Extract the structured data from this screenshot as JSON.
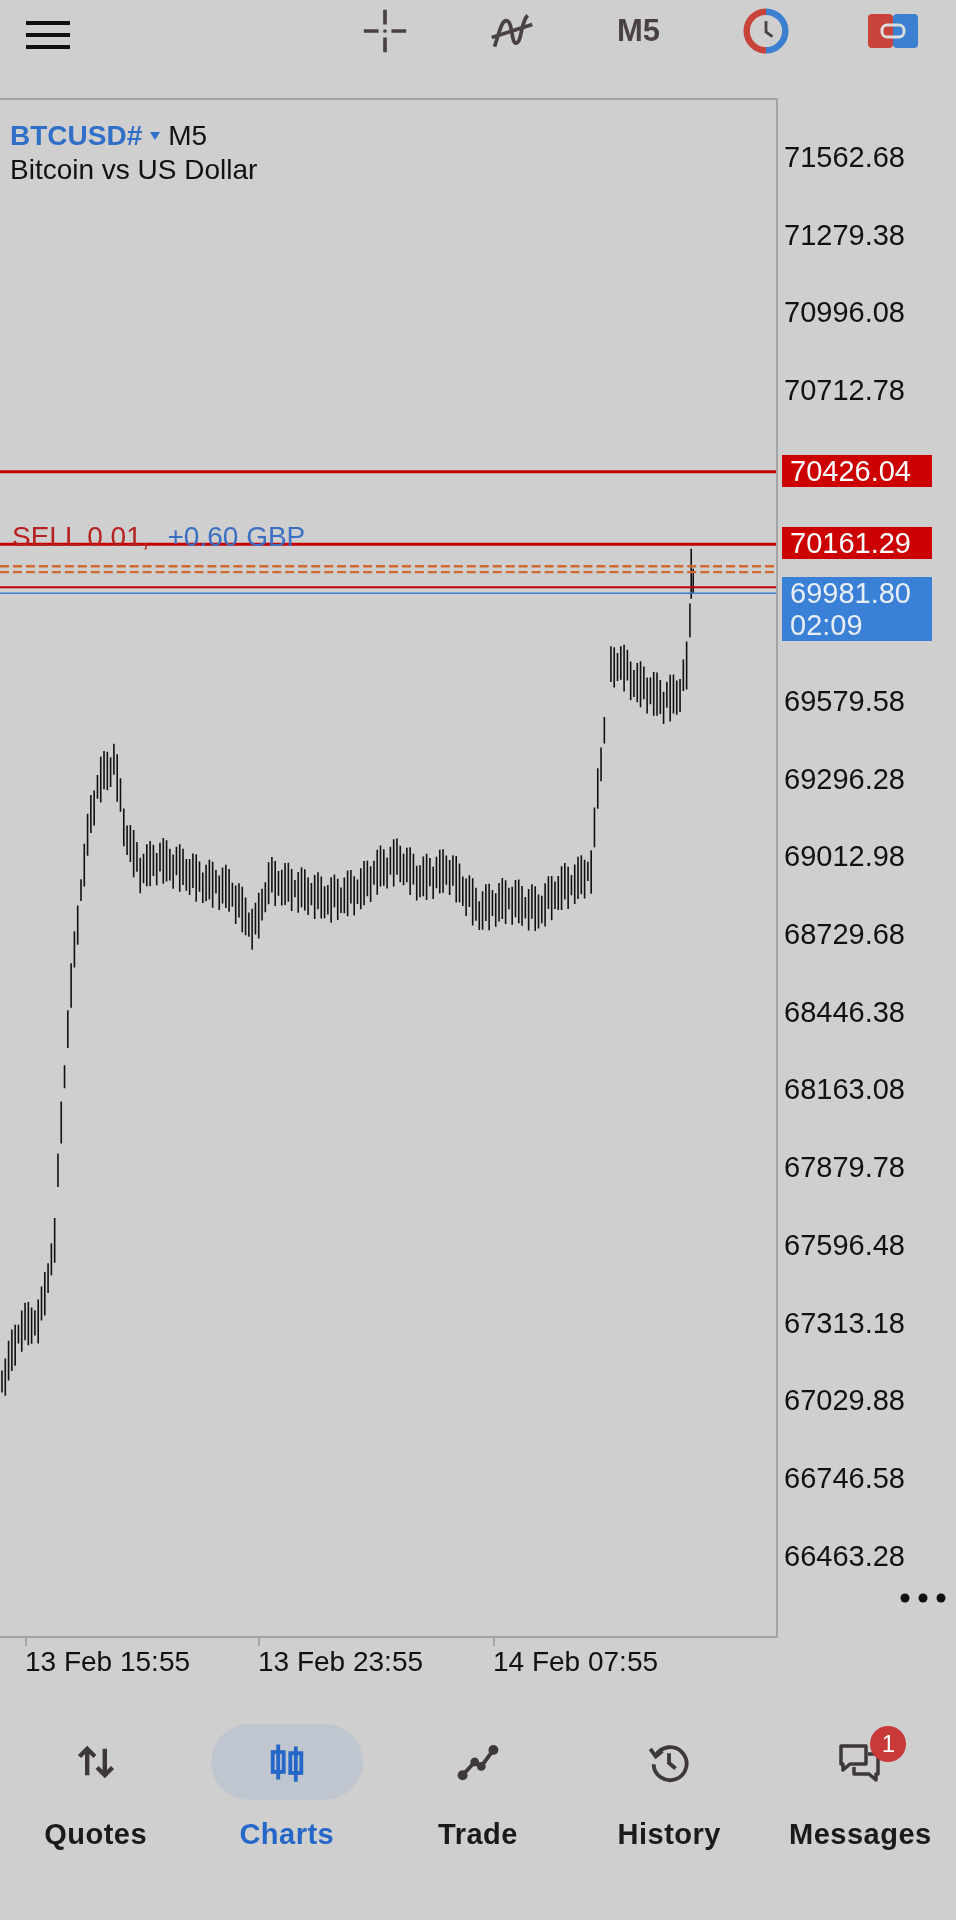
{
  "top_bar": {
    "timeframe": "M5"
  },
  "chart": {
    "symbol": "BTCUSD#",
    "timeframe": "M5",
    "description": "Bitcoin vs US Dollar",
    "price_axis": [
      "71562.68",
      "71279.38",
      "70996.08",
      "70712.78",
      "69579.58",
      "69296.28",
      "69012.98",
      "68729.68",
      "68446.38",
      "68163.08",
      "67879.78",
      "67596.48",
      "67313.18",
      "67029.88",
      "66746.58",
      "66463.28"
    ],
    "levels": [
      {
        "kind": "line",
        "price": "70426.04"
      },
      {
        "kind": "order",
        "price": "70161.29",
        "label": "SELL 0.01,",
        "profit": "+0.60 GBP"
      },
      {
        "kind": "bid",
        "price": "69981.80",
        "timer": "02:09"
      }
    ],
    "time_axis": [
      "13 Feb 15:55",
      "13 Feb 23:55",
      "14 Feb 07:55"
    ]
  },
  "nav": [
    {
      "kind": "quotes",
      "label": "Quotes",
      "selected": false
    },
    {
      "kind": "charts",
      "label": "Charts",
      "selected": true
    },
    {
      "kind": "trade",
      "label": "Trade",
      "selected": false
    },
    {
      "kind": "history",
      "label": "History",
      "selected": false
    },
    {
      "kind": "messages",
      "label": "Messages",
      "selected": false,
      "badge": "1"
    }
  ]
}
